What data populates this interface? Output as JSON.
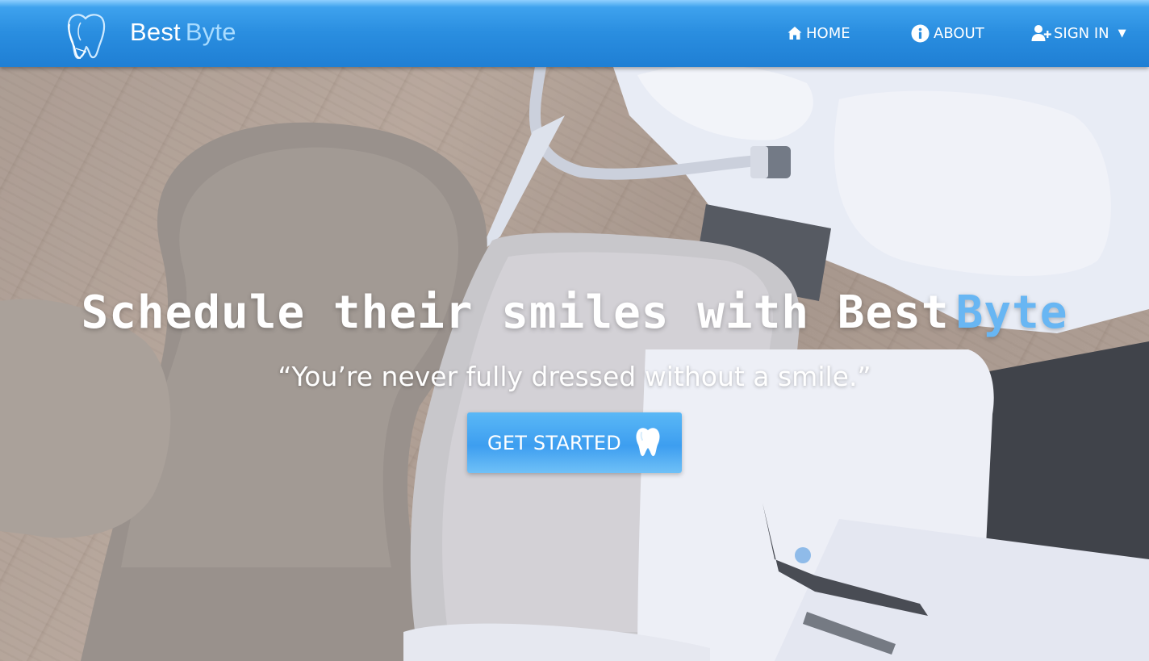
{
  "navbar": {
    "brand": {
      "first": "Best",
      "second": "Byte"
    },
    "icons": {
      "logo": "tooth-logo-icon",
      "home": "home-icon",
      "about": "info-icon",
      "signin": "user-plus-icon",
      "caret": "caret-down-icon"
    },
    "items": [
      {
        "label": "HOME"
      },
      {
        "label": "ABOUT"
      },
      {
        "label": "SIGN IN"
      }
    ]
  },
  "hero": {
    "headline_main": "Schedule their smiles with Best",
    "headline_accent": "Byte",
    "quote": "“You’re never fully dressed without a smile.”",
    "cta_label": "GET STARTED",
    "cta_icon": "tooth-icon",
    "background": "dental-chair-photo"
  },
  "colors": {
    "navbar": "#2a8ee0",
    "accent": "#68b6f3",
    "brand_accent": "#a9dcff",
    "button": "#3d9ef0",
    "text": "#ffffff"
  }
}
